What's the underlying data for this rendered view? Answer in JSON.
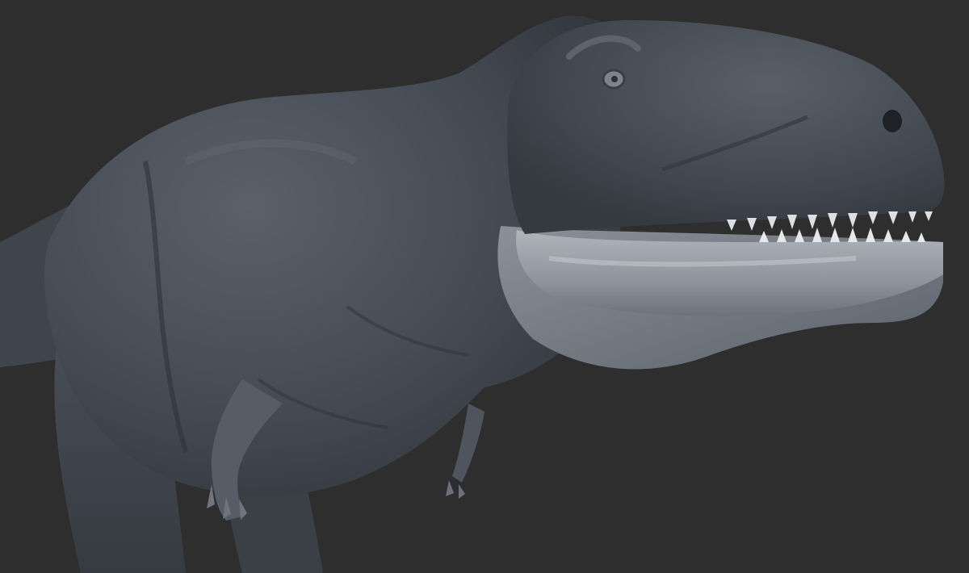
{
  "scene": {
    "subject": "dinosaur-sculpt-render",
    "colors": {
      "background": "#2e2e2e",
      "body": "#4a5059",
      "body_highlight": "#6b737d",
      "jaw_light": "#9aa0a8",
      "teeth": "#dcdfe3",
      "eye": "#7d8490",
      "nostril": "#1e2227"
    }
  }
}
